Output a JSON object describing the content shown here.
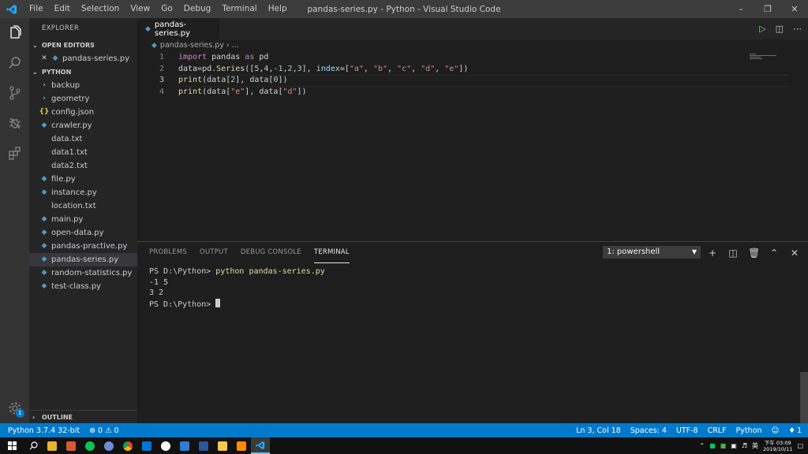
{
  "titlebar": {
    "menu": [
      "File",
      "Edit",
      "Selection",
      "View",
      "Go",
      "Debug",
      "Terminal",
      "Help"
    ],
    "title": "pandas-series.py - Python - Visual Studio Code"
  },
  "sidebar": {
    "title": "EXPLORER",
    "open_editors_header": "OPEN EDITORS",
    "open_editors": [
      {
        "name": "pandas-series.py"
      }
    ],
    "folder_header": "PYTHON",
    "items": [
      {
        "name": "backup",
        "type": "folder"
      },
      {
        "name": "geometry",
        "type": "folder"
      },
      {
        "name": "config.json",
        "type": "json"
      },
      {
        "name": "crawler.py",
        "type": "py"
      },
      {
        "name": "data.txt",
        "type": "txt"
      },
      {
        "name": "data1.txt",
        "type": "txt"
      },
      {
        "name": "data2.txt",
        "type": "txt"
      },
      {
        "name": "file.py",
        "type": "py"
      },
      {
        "name": "instance.py",
        "type": "py"
      },
      {
        "name": "location.txt",
        "type": "txt"
      },
      {
        "name": "main.py",
        "type": "py"
      },
      {
        "name": "open-data.py",
        "type": "py"
      },
      {
        "name": "pandas-practive.py",
        "type": "py"
      },
      {
        "name": "pandas-series.py",
        "type": "py"
      },
      {
        "name": "random-statistics.py",
        "type": "py"
      },
      {
        "name": "test-class.py",
        "type": "py"
      }
    ],
    "active_item": "pandas-series.py",
    "outline_header": "OUTLINE"
  },
  "editor": {
    "tab": "pandas-series.py",
    "breadcrumb": [
      "pandas-series.py",
      "..."
    ],
    "lines": [
      {
        "n": "1",
        "tokens": [
          [
            "kw",
            "import"
          ],
          [
            "txt",
            " pandas "
          ],
          [
            "kw",
            "as"
          ],
          [
            "txt",
            " pd"
          ]
        ]
      },
      {
        "n": "2",
        "tokens": [
          [
            "txt",
            "data=pd."
          ],
          [
            "fn",
            "Series"
          ],
          [
            "txt",
            "(["
          ],
          [
            "num",
            "5"
          ],
          [
            "txt",
            ","
          ],
          [
            "num",
            "4"
          ],
          [
            "txt",
            ","
          ],
          [
            "num",
            "-1"
          ],
          [
            "txt",
            ","
          ],
          [
            "num",
            "2"
          ],
          [
            "txt",
            ","
          ],
          [
            "num",
            "3"
          ],
          [
            "txt",
            "], "
          ],
          [
            "prm",
            "index"
          ],
          [
            "txt",
            "=["
          ],
          [
            "str",
            "\"a\""
          ],
          [
            "txt",
            ", "
          ],
          [
            "str",
            "\"b\""
          ],
          [
            "txt",
            ", "
          ],
          [
            "str",
            "\"c\""
          ],
          [
            "txt",
            ", "
          ],
          [
            "str",
            "\"d\""
          ],
          [
            "txt",
            ", "
          ],
          [
            "str",
            "\"e\""
          ],
          [
            "txt",
            "])"
          ]
        ]
      },
      {
        "n": "3",
        "tokens": [
          [
            "fn",
            "print"
          ],
          [
            "txt",
            "(data["
          ],
          [
            "num",
            "2"
          ],
          [
            "txt",
            "], data["
          ],
          [
            "num",
            "0"
          ],
          [
            "txt",
            "])"
          ]
        ]
      },
      {
        "n": "4",
        "tokens": [
          [
            "fn",
            "print"
          ],
          [
            "txt",
            "(data["
          ],
          [
            "str",
            "\"e\""
          ],
          [
            "txt",
            "], data["
          ],
          [
            "str",
            "\"d\""
          ],
          [
            "txt",
            "])"
          ]
        ]
      }
    ]
  },
  "panel": {
    "tabs": [
      "PROBLEMS",
      "OUTPUT",
      "DEBUG CONSOLE",
      "TERMINAL"
    ],
    "active_tab": "TERMINAL",
    "terminal_select": "1: powershell",
    "terminal": {
      "prompt": "PS D:\\Python> ",
      "command": "python pandas-series.py",
      "output": [
        "-1 5",
        "3 2"
      ],
      "prompt2": "PS D:\\Python> "
    }
  },
  "statusbar": {
    "interpreter": "Python 3.7.4 32-bit",
    "errors": "0",
    "warnings": "0",
    "position": "Ln 3, Col 18",
    "spaces": "Spaces: 4",
    "encoding": "UTF-8",
    "eol": "CRLF",
    "language": "Python",
    "notifications": "1"
  },
  "taskbar": {
    "clock_line1": "下午 03:09",
    "clock_line2": "2019/10/11",
    "ime": "英"
  },
  "colors": {
    "accent": "#007acc",
    "activity_bar": "#333333",
    "sidebar": "#252526",
    "editor_bg": "#1e1e1e",
    "python_icon": "#519aba"
  }
}
